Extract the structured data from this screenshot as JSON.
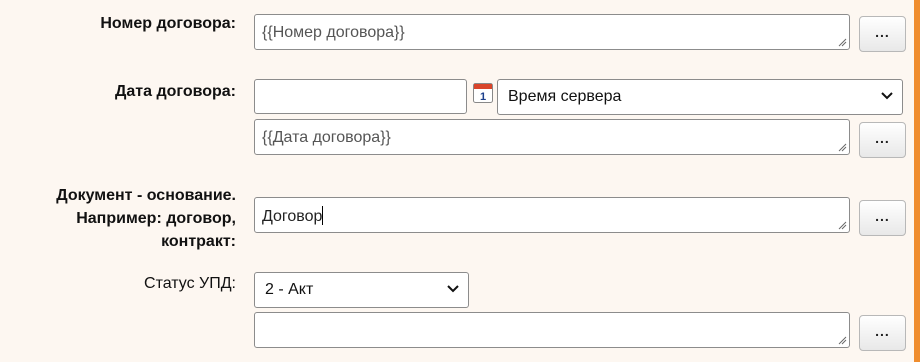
{
  "fields": {
    "contract_number": {
      "label": "Номер договора:",
      "value": "{{Номер договора}}",
      "button": "..."
    },
    "contract_date": {
      "label": "Дата договора:",
      "date_value": "",
      "timezone_select": "Время сервера",
      "value": "{{Дата договора}}",
      "button": "..."
    },
    "basis_document": {
      "label_line1": "Документ - основание.",
      "label_line2": "Например: договор,",
      "label_line3": "контракт:",
      "value": "Договор",
      "button": "..."
    },
    "upd_status": {
      "label": "Статус УПД:",
      "select": "2 - Акт",
      "value": "",
      "button": "..."
    }
  },
  "colors": {
    "background": "#fdf7f1",
    "accent_border": "#ef8d2e"
  },
  "icons": {
    "calendar": "calendar-icon",
    "dropdown": "chevron-down-icon",
    "resize": "resize-grip-icon"
  }
}
